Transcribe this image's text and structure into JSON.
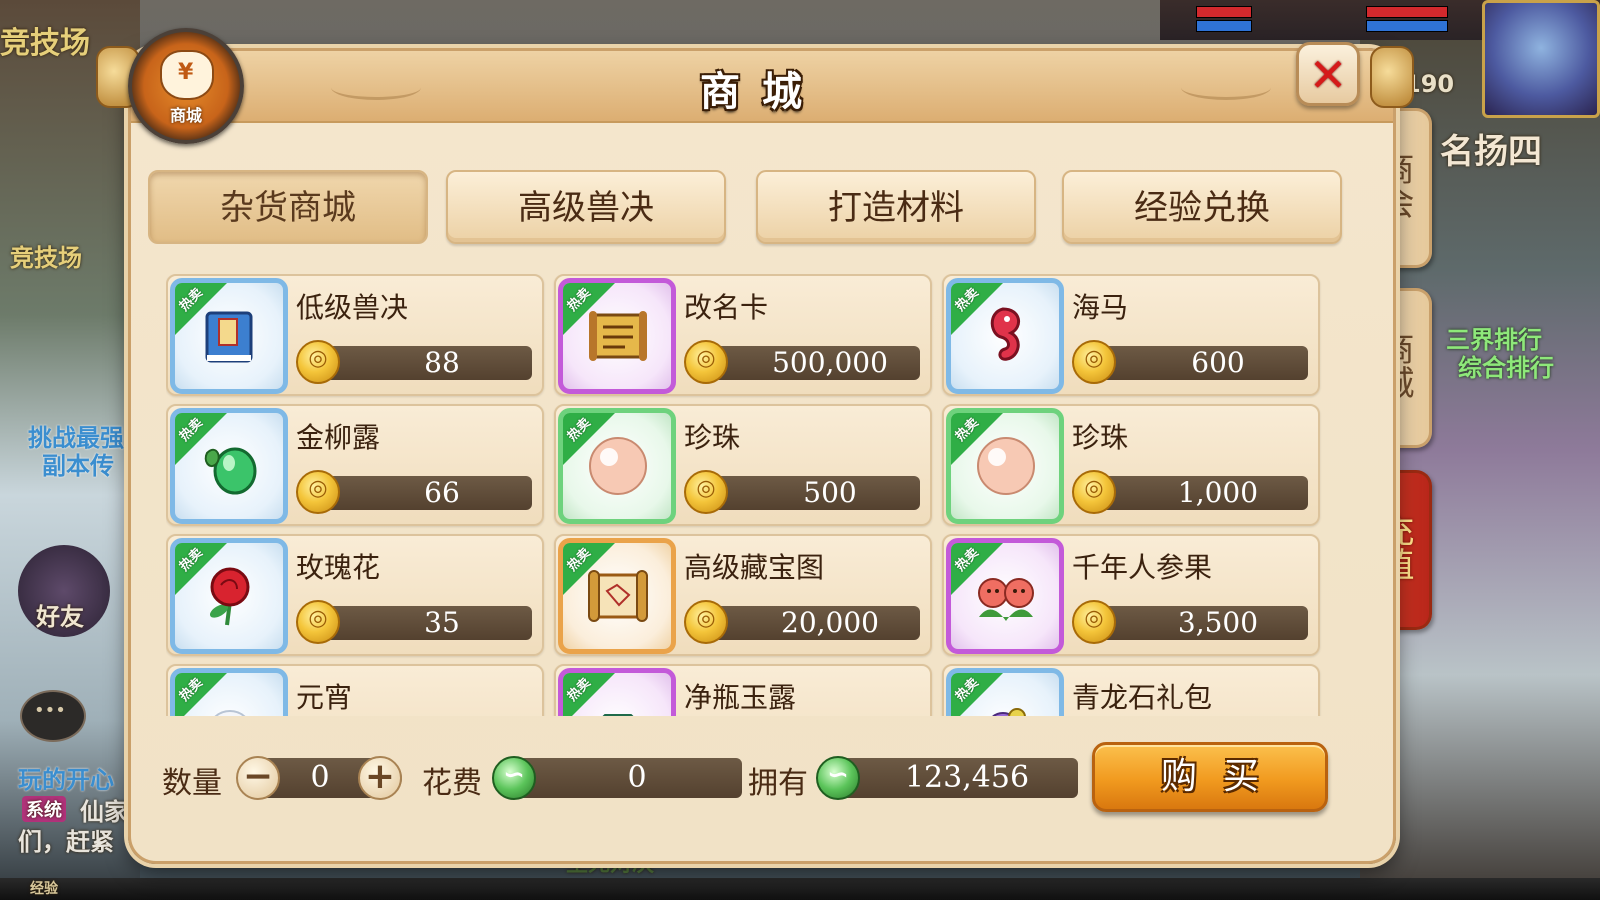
{
  "background": {
    "arena_top": "竞技场",
    "arena_left": "竞技场",
    "challenge_line1": "挑战最强",
    "challenge_line2": "副本传",
    "friend_label": "好友",
    "ranking_line1": "三界排行",
    "ranking_line2": "综合排行",
    "fame": "名扬四",
    "level_number": "190",
    "chat_line1": "玩的开心",
    "chat_system_tag": "系统",
    "chat_line2": "仙家",
    "chat_line3": "们，赶紧",
    "bottom_label": "经验",
    "pk_text": "生死对决"
  },
  "header": {
    "title": "商城",
    "badge_label": "商城",
    "close_icon": "close-x-icon"
  },
  "tabs": [
    {
      "label": "杂货商城",
      "active": true
    },
    {
      "label": "高级兽决",
      "active": false
    },
    {
      "label": "打造材料",
      "active": false
    },
    {
      "label": "经验兑换",
      "active": false
    }
  ],
  "side_tabs": [
    {
      "label": "商会"
    },
    {
      "label": "商城"
    },
    {
      "label": "充值"
    }
  ],
  "hot_tag": "热卖",
  "items": [
    {
      "name": "低级兽决",
      "price": "88",
      "frame": "blue",
      "icon": "book-icon"
    },
    {
      "name": "改名卡",
      "price": "500,000",
      "frame": "purple",
      "icon": "scroll-icon"
    },
    {
      "name": "海马",
      "price": "600",
      "frame": "blue",
      "icon": "seahorse-icon"
    },
    {
      "name": "金柳露",
      "price": "66",
      "frame": "blue",
      "icon": "potion-icon"
    },
    {
      "name": "珍珠",
      "price": "500",
      "frame": "green",
      "icon": "pearl-icon"
    },
    {
      "name": "珍珠",
      "price": "1,000",
      "frame": "green",
      "icon": "pearl-icon"
    },
    {
      "name": "玫瑰花",
      "price": "35",
      "frame": "blue",
      "icon": "rose-icon"
    },
    {
      "name": "高级藏宝图",
      "price": "20,000",
      "frame": "orange",
      "icon": "treasure-map-icon"
    },
    {
      "name": "千年人参果",
      "price": "3,500",
      "frame": "purple",
      "icon": "ginseng-fruit-icon"
    },
    {
      "name": "元宵",
      "price": "",
      "frame": "blue",
      "icon": "dumpling-icon"
    },
    {
      "name": "净瓶玉露",
      "price": "",
      "frame": "purple",
      "icon": "vase-icon"
    },
    {
      "name": "青龙石礼包",
      "price": "",
      "frame": "blue",
      "icon": "gift-bag-icon"
    }
  ],
  "footer": {
    "quantity_label": "数量",
    "quantity_value": "0",
    "minus": "−",
    "plus": "+",
    "cost_label": "花费",
    "cost_value": "0",
    "own_label": "拥有",
    "own_value": "123,456",
    "buy_label": "购买"
  },
  "colors": {
    "panel_bg": "#f4e6cd",
    "hot_tag": "#2fae46",
    "price_bar": "#54412f",
    "buy_button": "#f19a1f",
    "recharge_tab": "#c8301e"
  }
}
